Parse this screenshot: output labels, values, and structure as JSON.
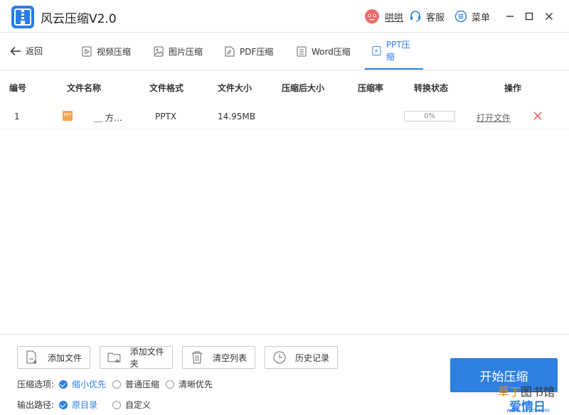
{
  "window": {
    "title": "风云压缩V2.0",
    "user_name": "哄哄",
    "service_label": "客服",
    "menu_label": "菜单"
  },
  "tabs": {
    "back_label": "返回",
    "items": [
      {
        "label": "视频压缩",
        "icon": "video-file-icon",
        "active": false
      },
      {
        "label": "图片压缩",
        "icon": "image-file-icon",
        "active": false
      },
      {
        "label": "PDF压缩",
        "icon": "pdf-file-icon",
        "active": false
      },
      {
        "label": "Word压缩",
        "icon": "word-file-icon",
        "active": false
      },
      {
        "label": "PPT压缩",
        "icon": "ppt-file-icon",
        "active": true
      }
    ]
  },
  "table": {
    "headers": [
      "编号",
      "文件名称",
      "文件格式",
      "文件大小",
      "压缩后大小",
      "压缩率",
      "转换状态",
      "操作"
    ],
    "rows": [
      {
        "index": "1",
        "icon_text": "PPT",
        "name": "＿ 方…",
        "format": "PPTX",
        "size": "14.95MB",
        "compressed_size": "",
        "ratio": "",
        "progress_text": "0%",
        "progress": 0,
        "action_label": "打开文件"
      }
    ]
  },
  "toolbar": {
    "add_file": "添加文件",
    "add_folder": "添加文件夹",
    "clear_list": "清空列表",
    "history": "历史记录"
  },
  "options": {
    "compress_label": "压缩选项:",
    "compress_choices": [
      {
        "label": "缩小优先",
        "checked": true
      },
      {
        "label": "普通压缩",
        "checked": false
      },
      {
        "label": "清晰优先",
        "checked": false
      }
    ],
    "output_label": "输出路径:",
    "output_choices": [
      {
        "label": "原目录",
        "checked": true
      },
      {
        "label": "自定义",
        "checked": false
      }
    ]
  },
  "start_label": "开始压缩",
  "watermark": {
    "line1_a": "草丁",
    "line1_b": "图书馆",
    "line2": "爱情日",
    "line3": "www.aiqiri.com"
  },
  "colors": {
    "accent": "#2d7fe0",
    "ppt": "#f5a24a",
    "delete": "#e55353"
  }
}
